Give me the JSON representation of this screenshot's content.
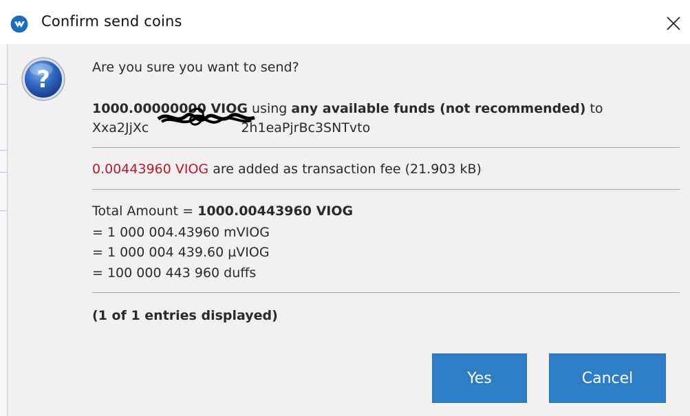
{
  "window": {
    "title": "Confirm send coins",
    "close_glyph": "✕",
    "app_icon": "app-logo-icon"
  },
  "message": {
    "icon": "question-icon",
    "question": "Are you sure you want to send?",
    "amount": "1000.00000000 VIOG",
    "using_text": "using",
    "funds_text": "any available funds (not recommended)",
    "to_text": "to",
    "address_prefix": "Xxa2JjXc",
    "address_suffix": "2h1eaPjrBc3SNTvto",
    "fee_amount": "0.00443960 VIOG",
    "fee_text": "are added as transaction fee (21.903 kB)",
    "total_label": "Total Amount =",
    "total_value": "1000.00443960 VIOG",
    "total_mviog": "= 1 000 004.43960 mVIOG",
    "total_uviog": "= 1 000 004 439.60 µVIOG",
    "total_duffs": "= 100 000 443 960 duffs",
    "entries": "(1 of 1 entries displayed)"
  },
  "buttons": {
    "yes": "Yes",
    "cancel": "Cancel"
  },
  "colors": {
    "accent": "#2d7ec7",
    "fee_red": "#b01c24",
    "background": "#f3f0f3"
  }
}
